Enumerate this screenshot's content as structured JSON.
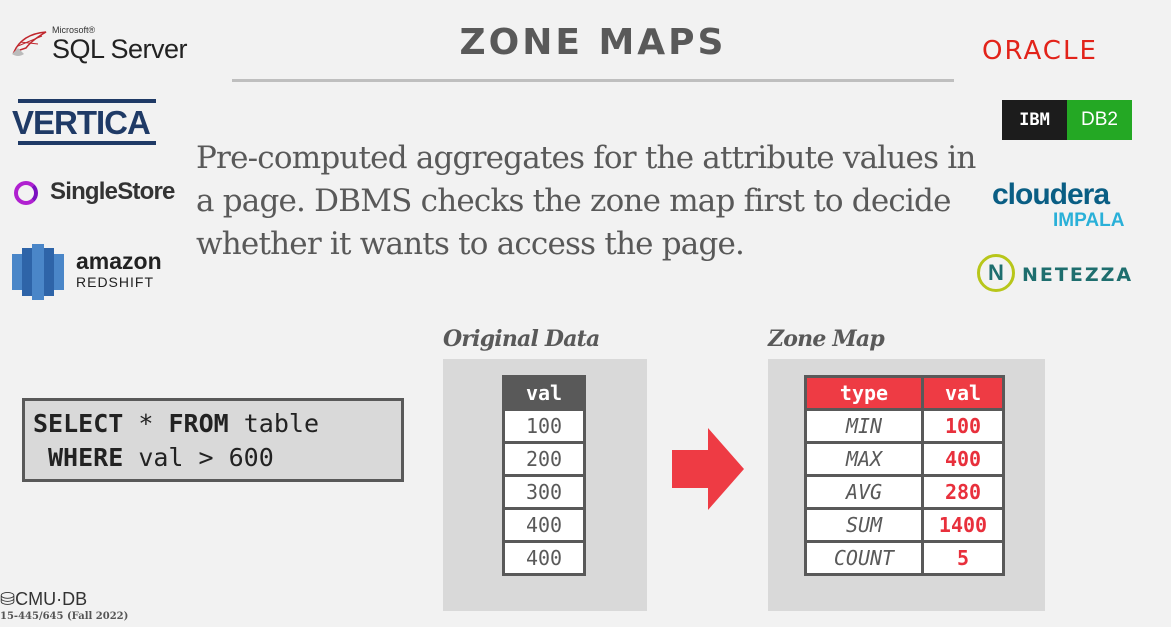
{
  "slide": {
    "title": "ZONE MAPS",
    "description": "Pre-computed aggregates for the attribute values in a page. DBMS checks the zone map first to decide whether it wants to access the page."
  },
  "logos": {
    "left": [
      {
        "name": "SQL Server",
        "prefix": "Microsoft®"
      },
      {
        "name": "VERTICA"
      },
      {
        "name": "SingleStore"
      },
      {
        "name": "amazon",
        "sub": "REDSHIFT"
      }
    ],
    "right": [
      {
        "name": "ORACLE"
      },
      {
        "name": "IBM",
        "sub": "DB2"
      },
      {
        "name": "cloudera",
        "sub": "IMPALA"
      },
      {
        "name": "NETEZZA",
        "badge": "N"
      }
    ]
  },
  "query": {
    "kw1": "SELECT",
    "star": " * ",
    "kw2": "FROM",
    "table": " table",
    "kw3": "WHERE",
    "cond": " val > 600"
  },
  "original_data": {
    "label": "Original Data",
    "header": "val",
    "rows": [
      "100",
      "200",
      "300",
      "400",
      "400"
    ]
  },
  "zone_map": {
    "label": "Zone Map",
    "headers": [
      "type",
      "val"
    ],
    "rows": [
      {
        "type": "MIN",
        "val": "100"
      },
      {
        "type": "MAX",
        "val": "400"
      },
      {
        "type": "AVG",
        "val": "280"
      },
      {
        "type": "SUM",
        "val": "1400"
      },
      {
        "type": "COUNT",
        "val": "5"
      }
    ]
  },
  "footer": {
    "logo": "CMU·DB",
    "course": "15-445/645 (Fall 2022)"
  },
  "colors": {
    "accent_red": "#ee3b44",
    "header_gray": "#595959",
    "panel_gray": "#d9d9d9"
  }
}
